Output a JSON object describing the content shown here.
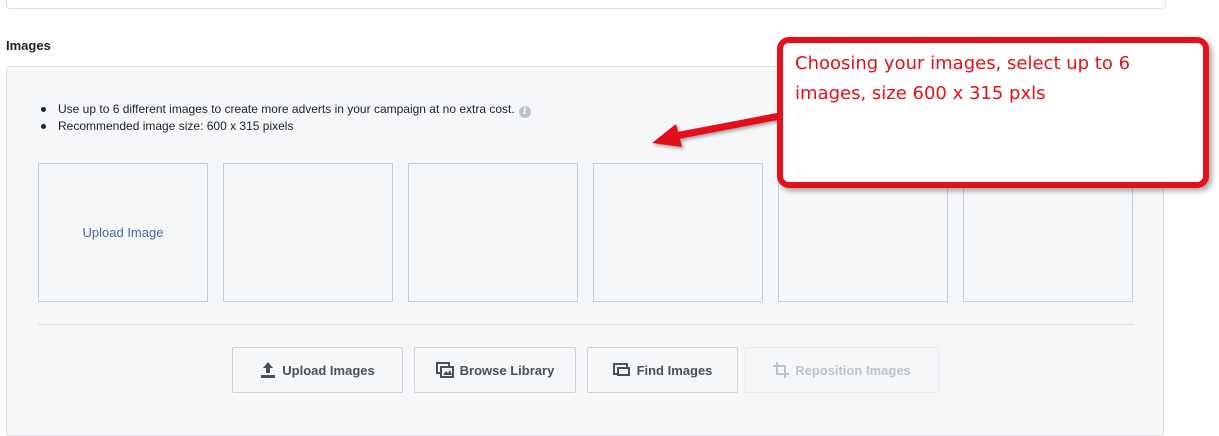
{
  "section": {
    "title": "Images"
  },
  "instructions": [
    "Use up to 6 different images to create more adverts in your campaign at no extra cost.",
    "Recommended image size: 600 x 315 pixels"
  ],
  "info_icon": {
    "icon": "info-icon",
    "glyph": "i"
  },
  "slots": [
    {
      "label": "Upload Image"
    },
    {
      "label": ""
    },
    {
      "label": ""
    },
    {
      "label": ""
    },
    {
      "label": ""
    },
    {
      "label": ""
    }
  ],
  "buttons": {
    "upload": {
      "label": "Upload Images",
      "icon": "upload-icon"
    },
    "browse": {
      "label": "Browse Library",
      "icon": "library-icon"
    },
    "find": {
      "label": "Find Images",
      "icon": "find-images-icon"
    },
    "reposition": {
      "label": "Reposition Images",
      "icon": "crop-icon",
      "enabled": false
    }
  },
  "callout": {
    "text": "Choosing your images, select up to 6 images, size 600 x 315 pxls"
  },
  "colors": {
    "callout_red": "#e4101b",
    "link_blue": "#4b67a1",
    "panel_bg": "#f6f7f9",
    "text": "#1d2129"
  }
}
